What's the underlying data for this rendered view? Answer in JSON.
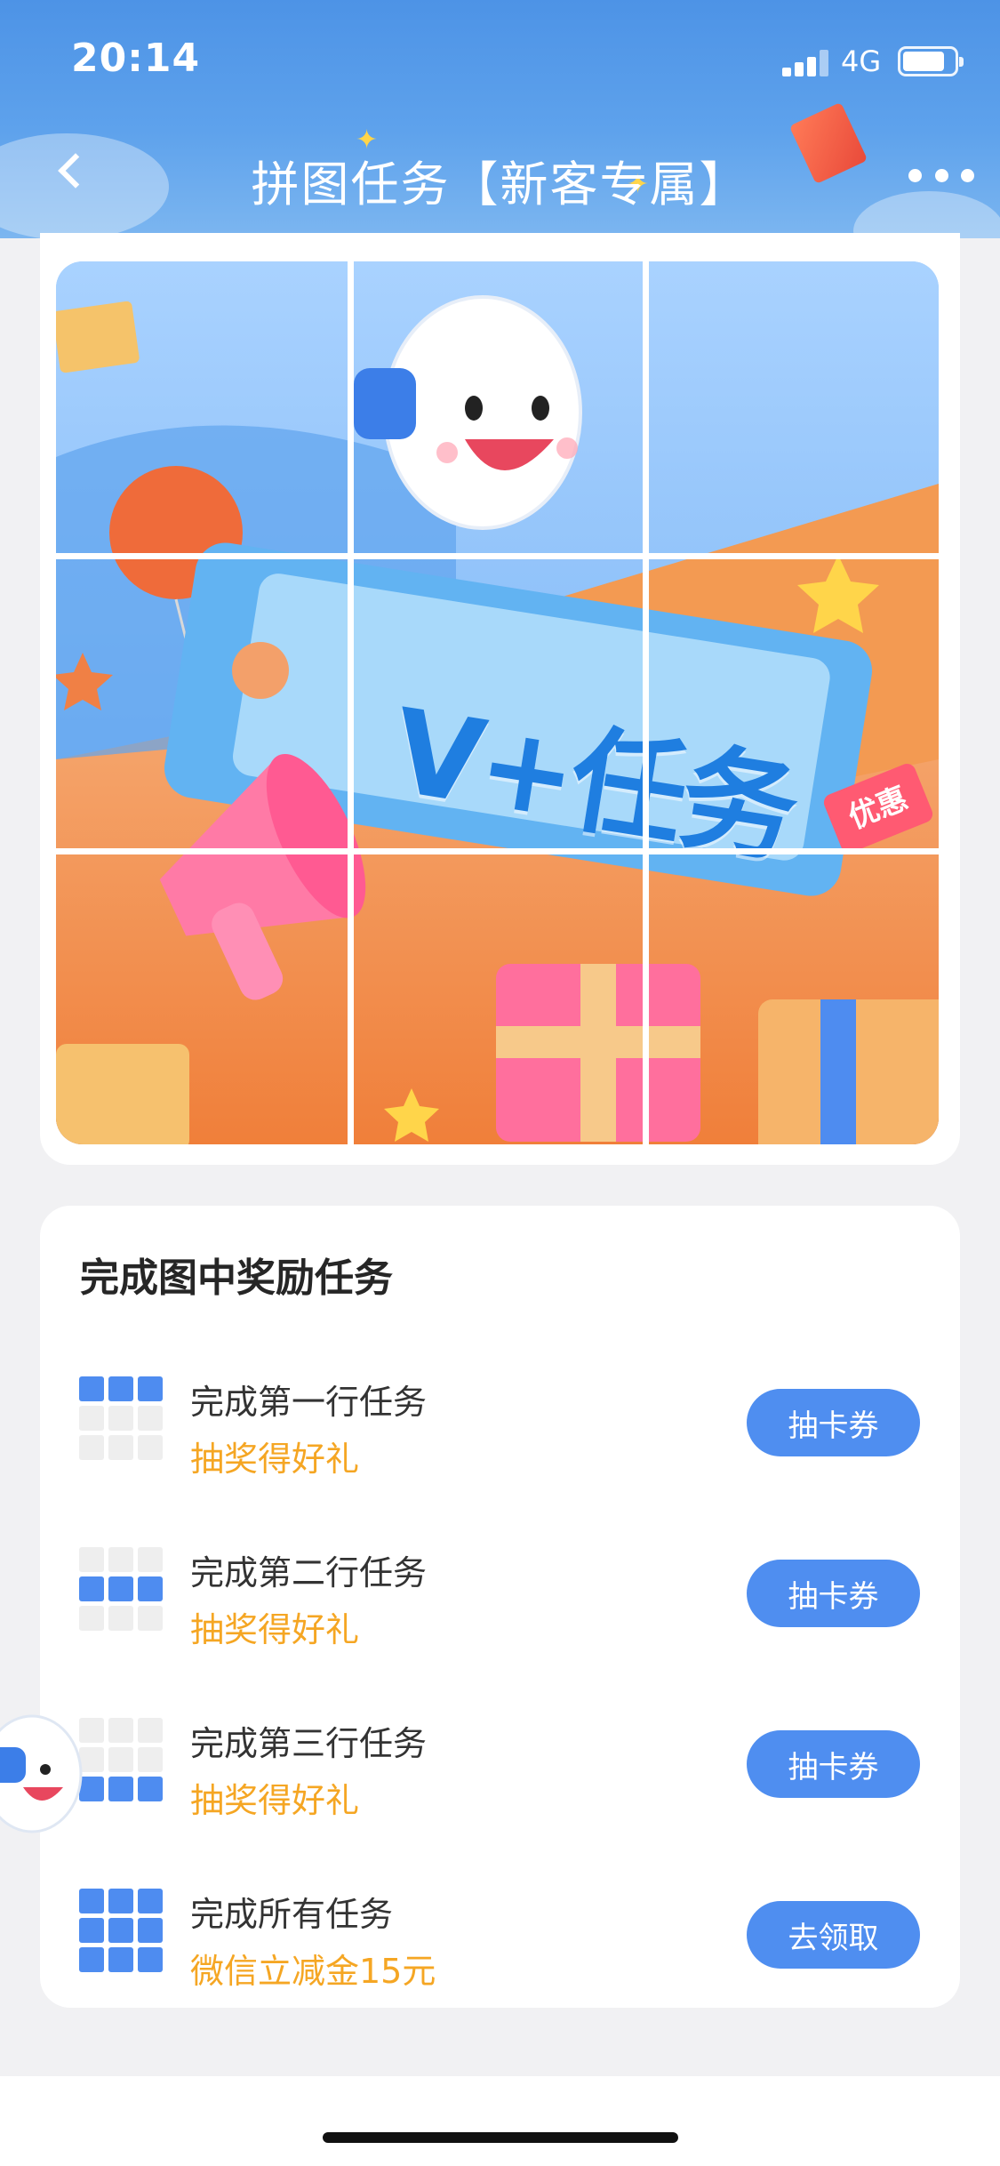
{
  "status_bar": {
    "time": "20:14",
    "network": "4G"
  },
  "nav": {
    "title": "拼图任务【新客专属】"
  },
  "puzzle": {
    "banner_text": "V+任务",
    "tag_text": "优惠"
  },
  "tasks": {
    "heading": "完成图中奖励任务",
    "items": [
      {
        "title": "完成第一行任务",
        "reward": "抽奖得好礼",
        "button": "抽卡券",
        "highlight_row": 1
      },
      {
        "title": "完成第二行任务",
        "reward": "抽奖得好礼",
        "button": "抽卡券",
        "highlight_row": 2
      },
      {
        "title": "完成第三行任务",
        "reward": "抽奖得好礼",
        "button": "抽卡券",
        "highlight_row": 3
      },
      {
        "title": "完成所有任务",
        "reward": "微信立减金15元",
        "button": "去领取",
        "highlight_row": "all"
      }
    ]
  },
  "colors": {
    "accent": "#4f8ef0",
    "reward": "#f5a623",
    "header": "#4d93e6"
  }
}
